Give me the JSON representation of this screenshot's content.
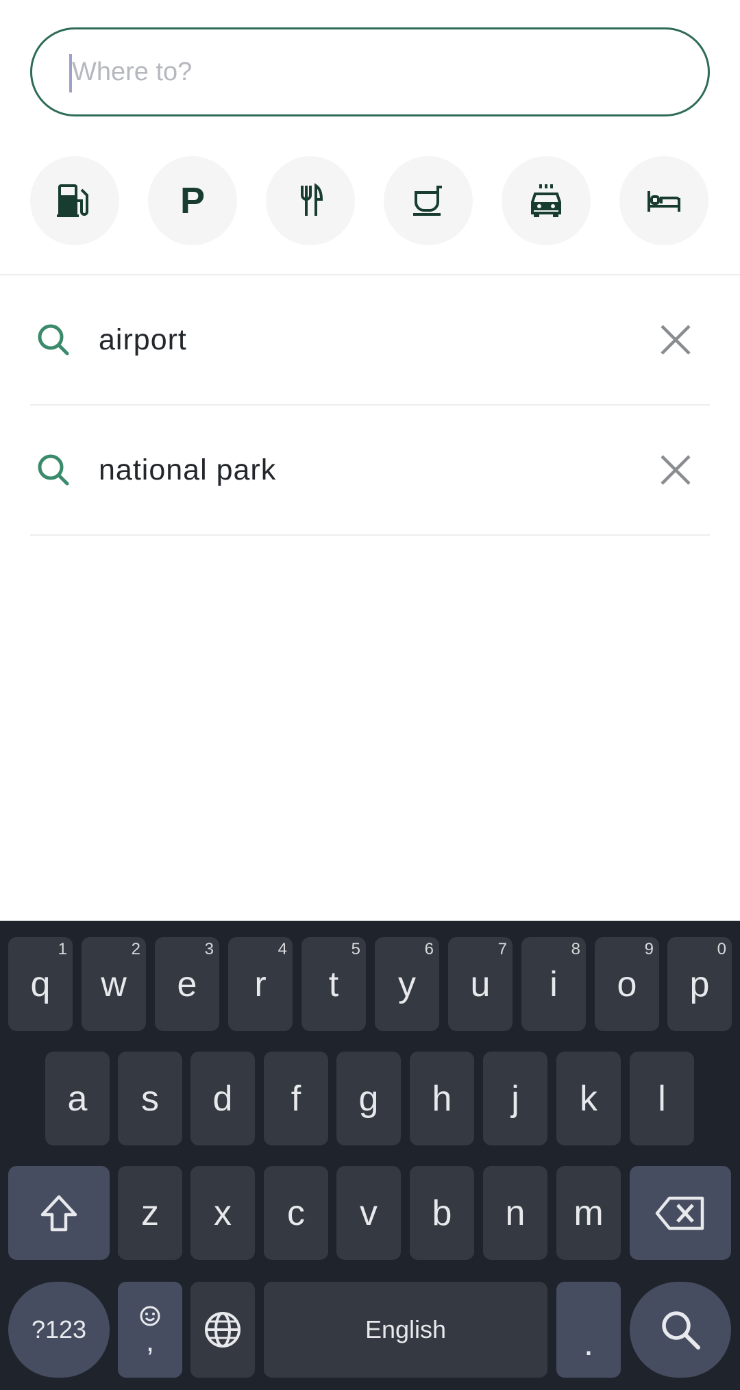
{
  "search": {
    "placeholder": "Where to?",
    "value": ""
  },
  "categories": [
    {
      "name": "fuel",
      "icon": "fuel-pump-icon"
    },
    {
      "name": "parking",
      "icon": "parking-icon",
      "label": "P"
    },
    {
      "name": "restaurants",
      "icon": "restaurant-icon"
    },
    {
      "name": "coffee",
      "icon": "coffee-cup-icon"
    },
    {
      "name": "car-rental",
      "icon": "car-icon"
    },
    {
      "name": "hotels",
      "icon": "bed-icon"
    }
  ],
  "recent": [
    {
      "label": "airport"
    },
    {
      "label": "national park"
    }
  ],
  "colors": {
    "accent": "#2e6b55",
    "icon": "#183d30",
    "keyboard_bg": "#1f232b",
    "key": "#353941",
    "key_mod": "#474d60"
  },
  "keyboard": {
    "row1": [
      {
        "key": "q",
        "hint": "1"
      },
      {
        "key": "w",
        "hint": "2"
      },
      {
        "key": "e",
        "hint": "3"
      },
      {
        "key": "r",
        "hint": "4"
      },
      {
        "key": "t",
        "hint": "5"
      },
      {
        "key": "y",
        "hint": "6"
      },
      {
        "key": "u",
        "hint": "7"
      },
      {
        "key": "i",
        "hint": "8"
      },
      {
        "key": "o",
        "hint": "9"
      },
      {
        "key": "p",
        "hint": "0"
      }
    ],
    "row2": [
      "a",
      "s",
      "d",
      "f",
      "g",
      "h",
      "j",
      "k",
      "l"
    ],
    "row3": [
      "z",
      "x",
      "c",
      "v",
      "b",
      "n",
      "m"
    ],
    "symbols": "?123",
    "comma": ",",
    "space": "English",
    "period": "."
  }
}
